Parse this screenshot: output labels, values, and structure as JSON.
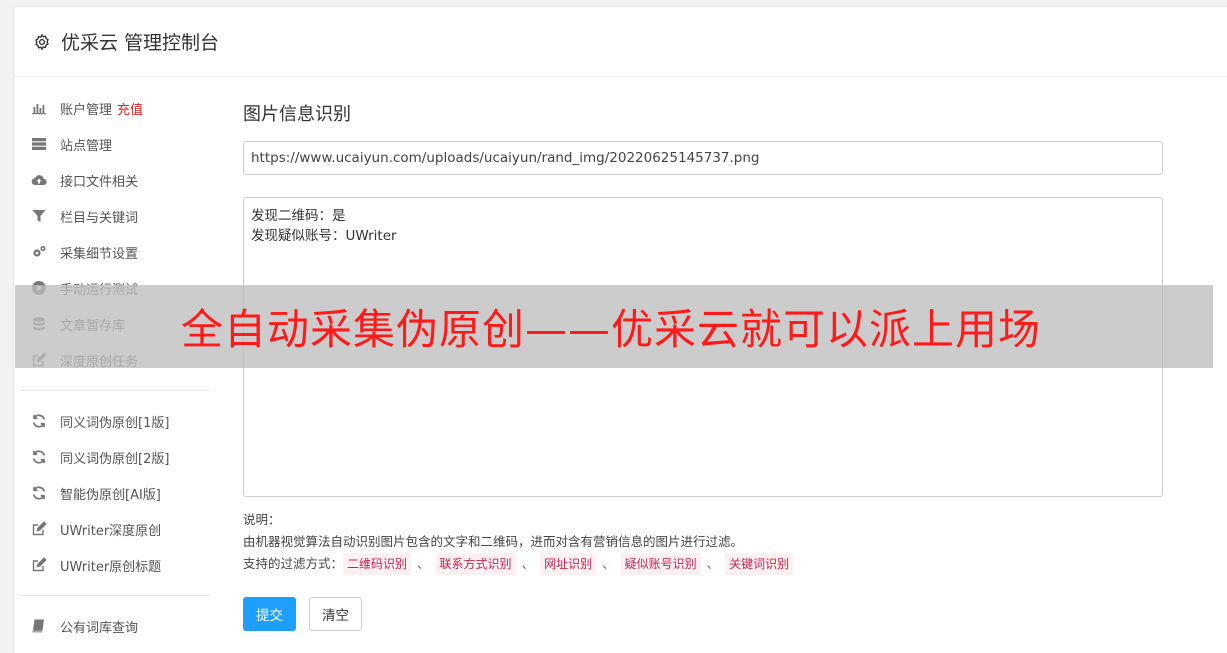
{
  "header": {
    "title": "优采云 管理控制台"
  },
  "sidebar": {
    "group1": [
      {
        "icon": "bar-chart-icon",
        "label": "账户管理",
        "extra": "充值"
      },
      {
        "icon": "server-icon",
        "label": "站点管理"
      },
      {
        "icon": "cloud-upload-icon",
        "label": "接口文件相关"
      },
      {
        "icon": "filter-icon",
        "label": "栏目与关键词"
      },
      {
        "icon": "gears-icon",
        "label": "采集细节设置"
      },
      {
        "icon": "play-circle-icon",
        "label": "手动运行测试"
      },
      {
        "icon": "database-icon",
        "label": "文章暂存库"
      },
      {
        "icon": "edit-icon",
        "label": "深度原创任务"
      }
    ],
    "group2": [
      {
        "icon": "refresh-icon",
        "label": "同义词伪原创[1版]"
      },
      {
        "icon": "refresh-icon",
        "label": "同义词伪原创[2版]"
      },
      {
        "icon": "refresh-icon",
        "label": "智能伪原创[AI版]"
      },
      {
        "icon": "edit-icon",
        "label": "UWriter深度原创"
      },
      {
        "icon": "edit-icon",
        "label": "UWriter原创标题"
      }
    ],
    "group3": [
      {
        "icon": "book-icon",
        "label": "公有词库查询"
      }
    ]
  },
  "main": {
    "title": "图片信息识别",
    "url_value": "https://www.ucaiyun.com/uploads/ucaiyun/rand_img/20220625145737.png",
    "result_text": "发现二维码：是\n发现疑似账号：UWriter",
    "desc_label": "说明：",
    "desc_text": "由机器视觉算法自动识别图片包含的文字和二维码，进而对含有营销信息的图片进行过滤。",
    "filter_label": "支持的过滤方式：",
    "filter_tags": [
      "二维码识别",
      "联系方式识别",
      "网址识别",
      "疑似账号识别",
      "关键词识别"
    ],
    "separator": "、",
    "submit_label": "提交",
    "clear_label": "清空"
  },
  "overlay": {
    "text": "全自动采集伪原创——优采云就可以派上用场"
  }
}
